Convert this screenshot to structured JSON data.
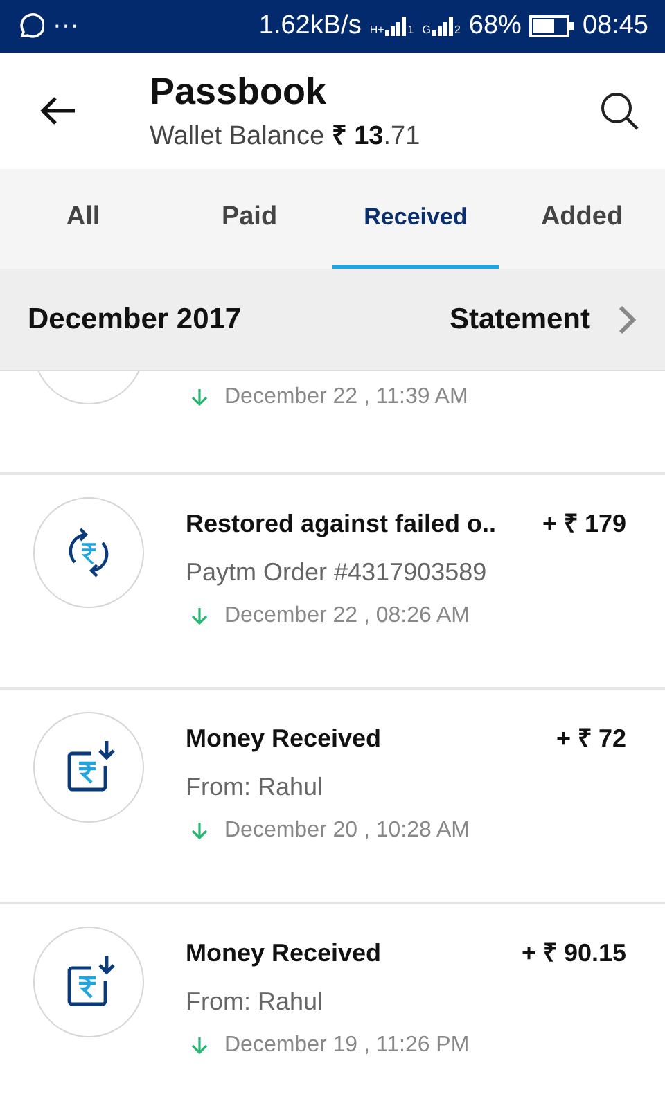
{
  "status_bar": {
    "more": "···",
    "speed": "1.62kB/s",
    "signals": [
      {
        "network": "H+",
        "sim": "1"
      },
      {
        "network": "G",
        "sim": "2"
      }
    ],
    "battery": "68%",
    "time": "08:45"
  },
  "header": {
    "title": "Passbook",
    "balance": "Wallet Balance **₹ 13**.71"
  },
  "tabs": [
    {
      "label": "All",
      "selected": false
    },
    {
      "label": "Paid",
      "selected": false
    },
    {
      "label": "Received",
      "selected": true
    },
    {
      "label": "Added",
      "selected": false
    }
  ],
  "month_bar": {
    "month": "December 2017",
    "statement": "Statement"
  },
  "transactions": [
    {
      "kind": "partial",
      "date": "December 22 , 11:39 AM"
    },
    {
      "kind": "restore",
      "title": "Restored against failed o..",
      "amount": "+ ₹ 179",
      "detail": "Paytm Order #4317903589",
      "date": "December 22 , 08:26 AM"
    },
    {
      "kind": "receive",
      "title": "Money Received",
      "amount": "+ ₹ 72",
      "detail": "From: Rahul",
      "date": "December 20 , 10:28 AM"
    },
    {
      "kind": "receive",
      "title": "Money Received",
      "amount": "+ ₹ 90.15",
      "detail": "From: Rahul",
      "date": "December 19 , 11:26 PM"
    }
  ]
}
